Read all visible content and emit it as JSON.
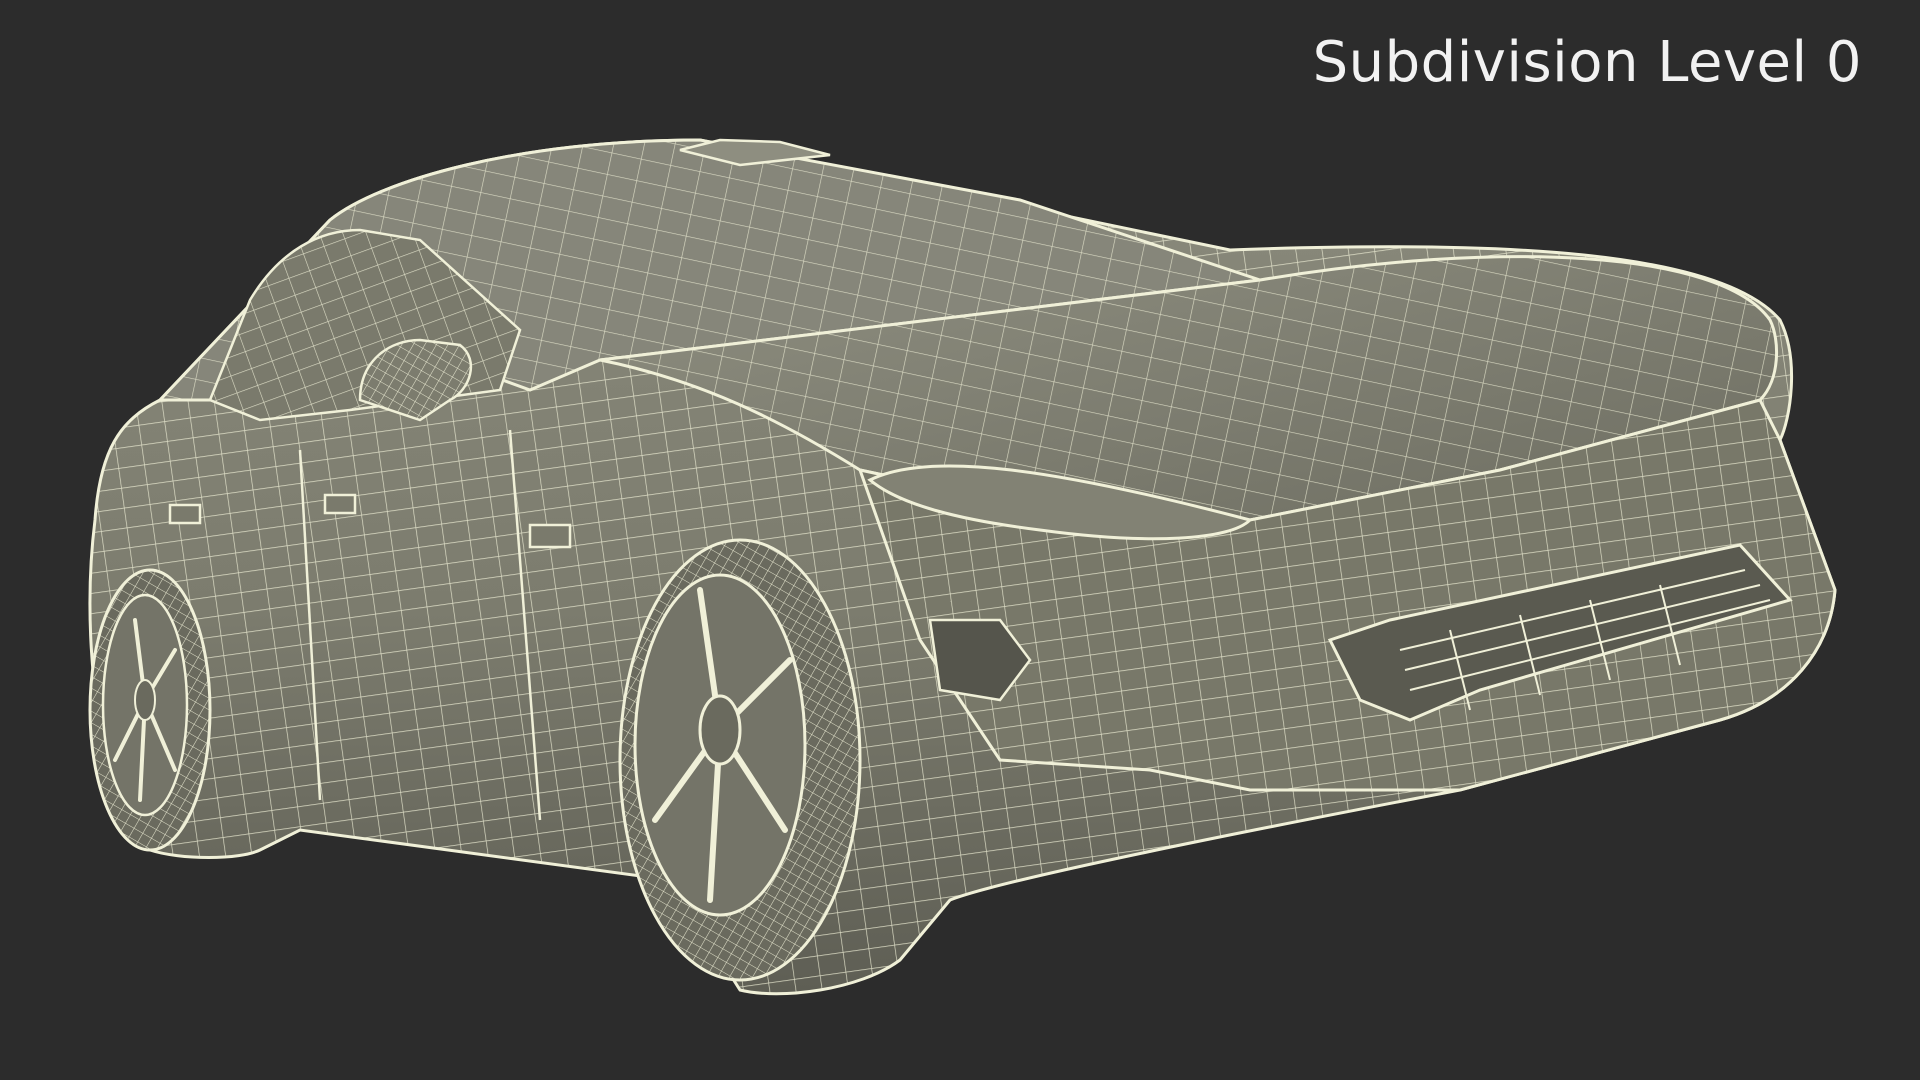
{
  "overlay": {
    "subdivision_label": "Subdivision Level 0"
  },
  "render": {
    "background_color": "#2c2c2c",
    "body_color": "#7e7e70",
    "shadow_color": "#5b5b51",
    "wire_color": "#f0f0d8",
    "label_color": "#f2f2f2"
  },
  "scene": {
    "subject": "car-wireframe-model",
    "visible_parts": [
      "body",
      "front-wheel",
      "rear-wheel",
      "side-mirror",
      "front-grille",
      "headlight"
    ]
  }
}
